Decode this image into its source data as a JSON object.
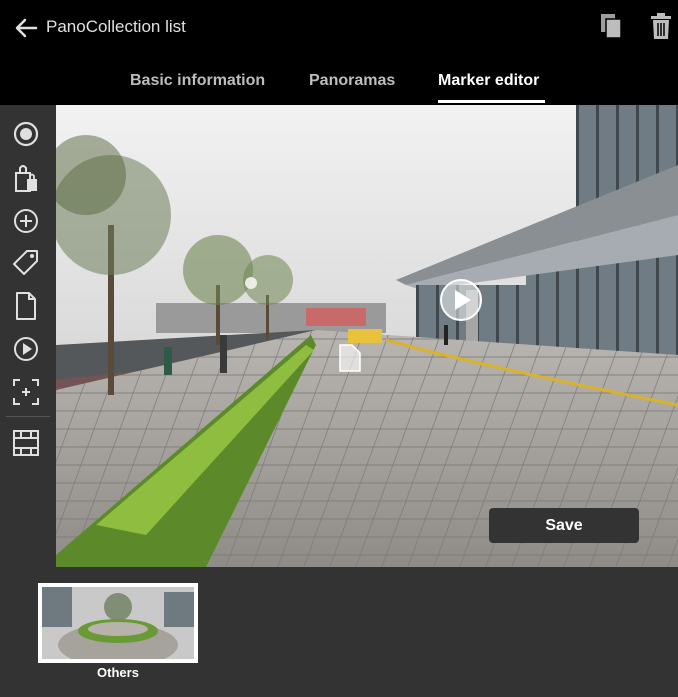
{
  "header": {
    "title": "PanoCollection list",
    "back_icon": "arrow-left-icon",
    "copy_icon": "copy-icon",
    "delete_icon": "trash-icon"
  },
  "tabs": [
    {
      "label": "Basic information",
      "active": false
    },
    {
      "label": "Panoramas",
      "active": false
    },
    {
      "label": "Marker editor",
      "active": true
    }
  ],
  "toolbar": {
    "tools": [
      "record-circle-icon",
      "shopping-bag-icon",
      "add-circle-icon",
      "tag-icon",
      "document-icon",
      "play-circle-icon",
      "focus-frame-icon",
      "film-strip-icon"
    ]
  },
  "viewer": {
    "markers": [
      "play-marker-icon",
      "document-marker-icon",
      "point-marker-icon"
    ],
    "save_label": "Save"
  },
  "thumbnails": [
    {
      "label": "Others",
      "selected": true
    }
  ],
  "colors": {
    "header_bg": "#000000",
    "panel_bg": "#333333",
    "tab_active": "#ffffff",
    "tab_inactive": "#bdbdbd"
  }
}
